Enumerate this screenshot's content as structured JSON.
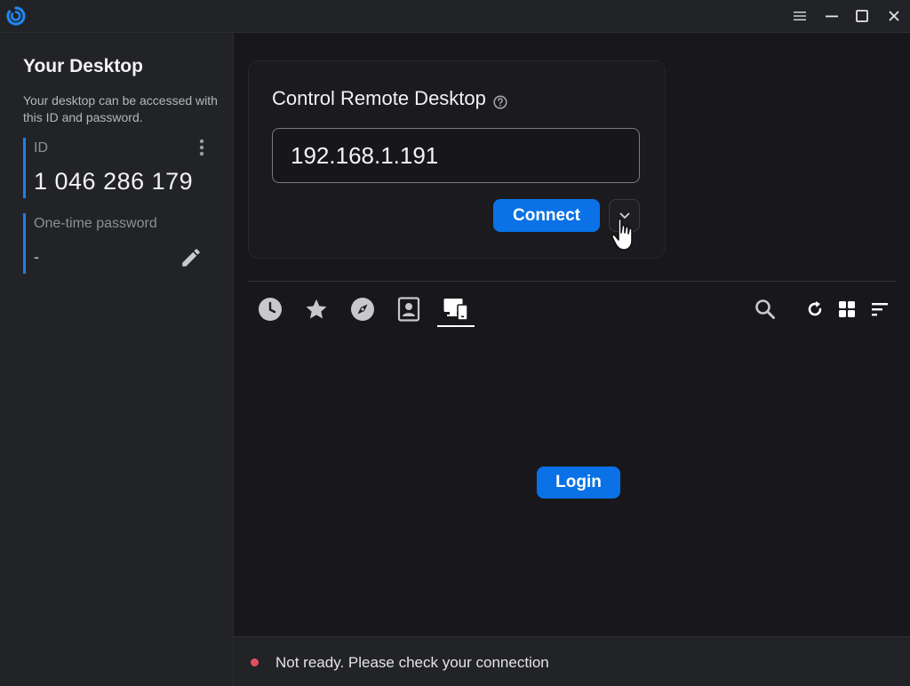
{
  "titlebar": {
    "icons": [
      "app-logo-icon",
      "menu-icon",
      "minimize-icon",
      "maximize-icon",
      "close-icon"
    ]
  },
  "your_desktop": {
    "title": "Your Desktop",
    "description": "Your desktop can be accessed with this ID and password.",
    "id_label": "ID",
    "id_value": "1 046 286 179",
    "password_label": "One-time password",
    "password_value": "-"
  },
  "control": {
    "title": "Control Remote Desktop",
    "address_value": "192.168.1.191",
    "connect_label": "Connect"
  },
  "tabs": [
    {
      "name": "recent",
      "icon": "clock-icon"
    },
    {
      "name": "favorites",
      "icon": "star-icon"
    },
    {
      "name": "discovered",
      "icon": "compass-icon"
    },
    {
      "name": "address-book",
      "icon": "contact-icon"
    },
    {
      "name": "accessible-devices",
      "icon": "devices-icon",
      "active": true
    }
  ],
  "main": {
    "login_label": "Login"
  },
  "status": {
    "text": "Not ready. Please check your connection",
    "dot_color": "#e0515f"
  },
  "colors": {
    "accent": "#0a72e6",
    "background": "#18181c",
    "panel": "#222327"
  }
}
